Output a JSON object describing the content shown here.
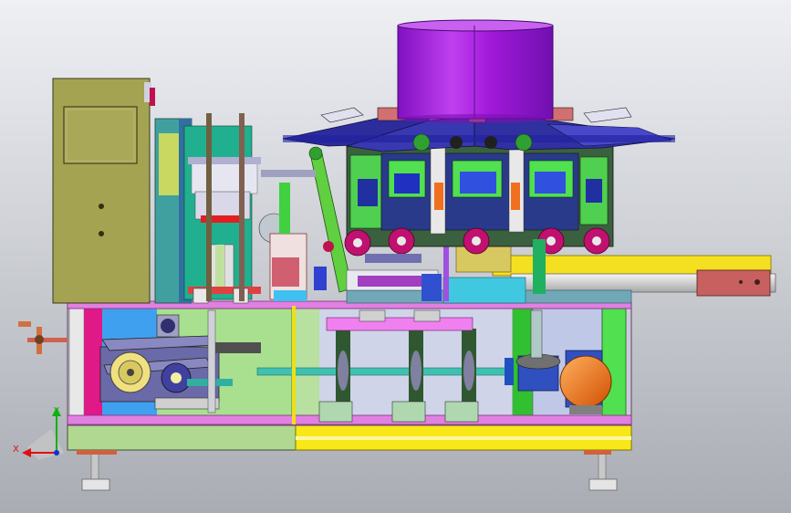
{
  "viewport": {
    "background_top": "#eef0f4",
    "background_bottom": "#a9acb3"
  },
  "triad": {
    "x_label": "X",
    "y_label": "Y",
    "x_color": "#e01010",
    "y_color": "#10b010",
    "z_color": "#1030d0"
  },
  "colors": {
    "hopper": "#a018d8",
    "frame_top": "#e080e0",
    "frame_base": "#f8e818",
    "frame_green": "#40d840",
    "control_box": "#a0a050",
    "umbrella": "#3030a0",
    "rail": "#d8d8d8",
    "motor": "#f07810",
    "shaft": "#30b0a0",
    "magenta_wheel": "#c01070"
  }
}
